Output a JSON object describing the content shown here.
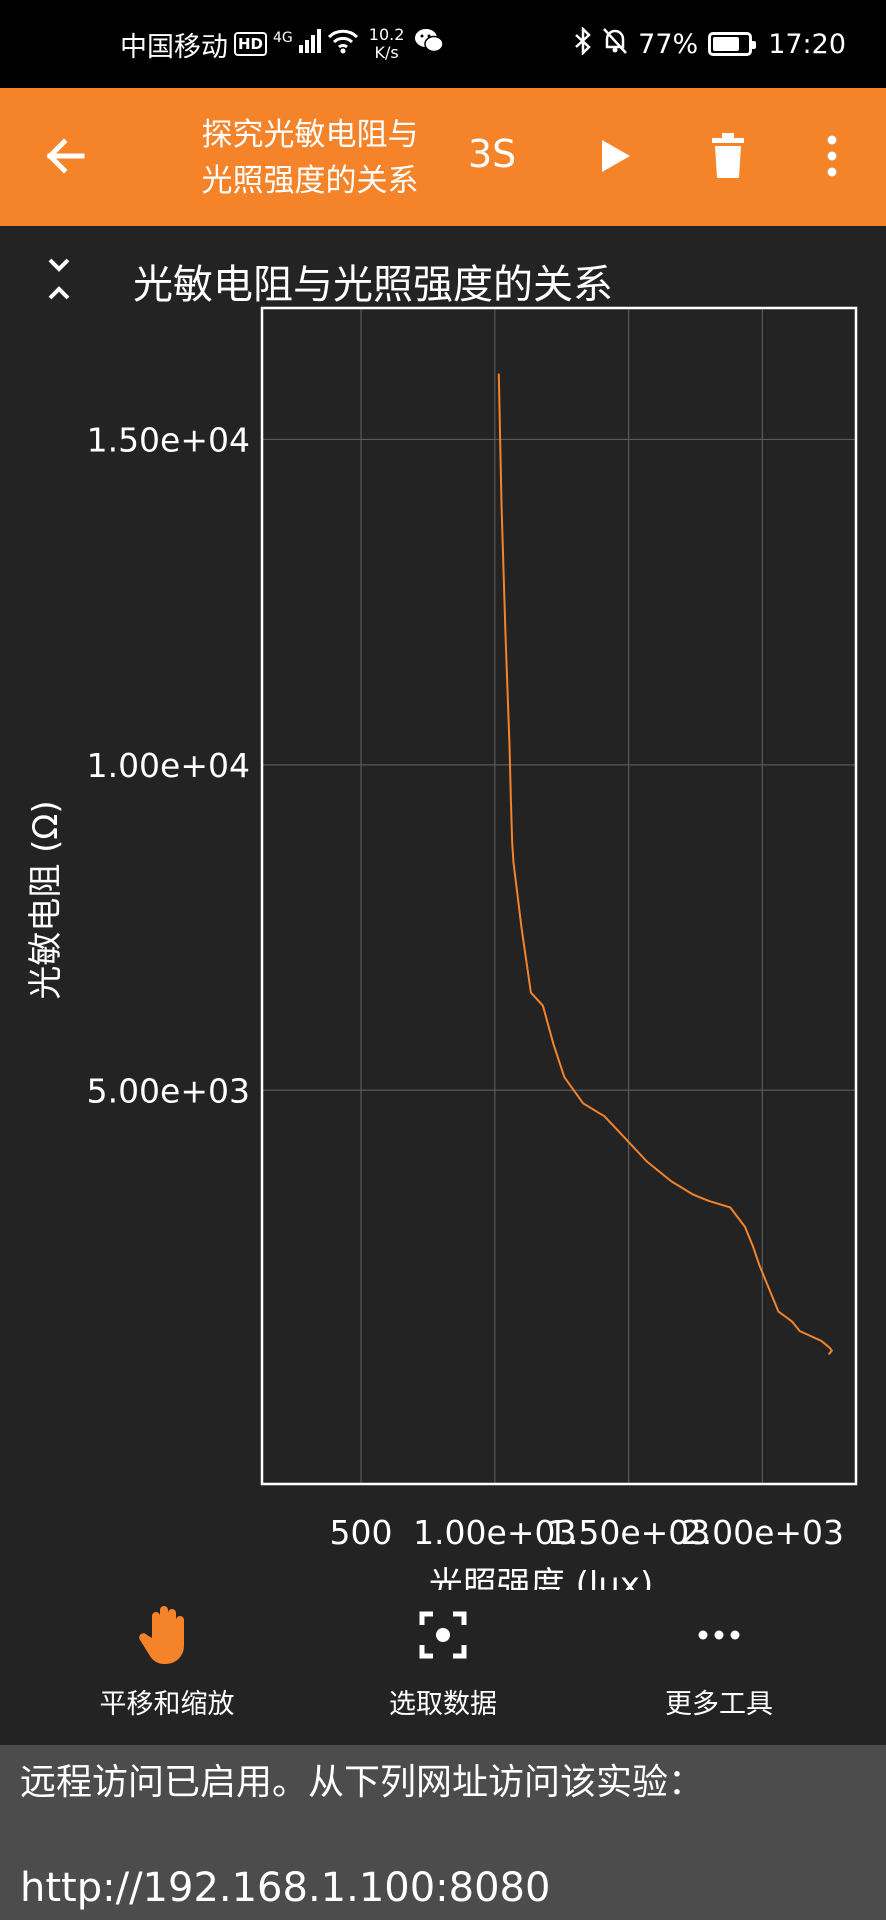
{
  "status_bar": {
    "carrier": "中国移动",
    "hd": "HD",
    "network": "4G",
    "speed_value": "10.2",
    "speed_unit": "K/s",
    "battery": "77%",
    "battery_level": 0.77,
    "time": "17:20"
  },
  "app_bar": {
    "title_line1": "探究光敏电阻与",
    "title_line2": "光照强度的关系",
    "timer": "3S"
  },
  "chart_header": {
    "title": "光敏电阻与光照强度的关系"
  },
  "chart_data": {
    "type": "line",
    "title": "光敏电阻与光照强度的关系",
    "xlabel": "光照强度 (lux)",
    "ylabel": "光敏电阻 (Ω)",
    "x_ticks": [
      {
        "value": 500,
        "label": "500"
      },
      {
        "value": 1000,
        "label": "1.00e+03"
      },
      {
        "value": 1500,
        "label": "1.50e+03"
      },
      {
        "value": 2000,
        "label": "2.00e+03"
      }
    ],
    "y_ticks": [
      {
        "value": 5000,
        "label": "5.00e+03"
      },
      {
        "value": 10000,
        "label": "1.00e+04"
      },
      {
        "value": 15000,
        "label": "1.50e+04"
      }
    ],
    "xlim": [
      130,
      2350
    ],
    "ylim": [
      -1050,
      17020
    ],
    "grid": true,
    "line_color": "#f4832a",
    "series": [
      {
        "x": [
          1015,
          1025,
          1040,
          1055,
          1060,
          1065,
          1070,
          1100,
          1135,
          1180,
          1220,
          1260,
          1330,
          1410,
          1490,
          1570,
          1660,
          1740,
          1800,
          1880,
          1935,
          1965,
          1990,
          2030,
          2060,
          2110,
          2140,
          2220,
          2250,
          2260,
          2250
        ],
        "y": [
          16000,
          14000,
          12000,
          10300,
          9500,
          8800,
          8500,
          7500,
          6500,
          6300,
          5700,
          5200,
          4800,
          4600,
          4250,
          3900,
          3600,
          3400,
          3300,
          3200,
          2900,
          2600,
          2300,
          1900,
          1600,
          1450,
          1300,
          1150,
          1050,
          1000,
          950
        ]
      }
    ]
  },
  "toolbar": {
    "pan_zoom": "平移和缩放",
    "select_data": "选取数据",
    "more_tools": "更多工具"
  },
  "remote": {
    "message": "远程访问已启用。从下列网址访问该实验：",
    "url": "http://192.168.1.100:8080"
  }
}
